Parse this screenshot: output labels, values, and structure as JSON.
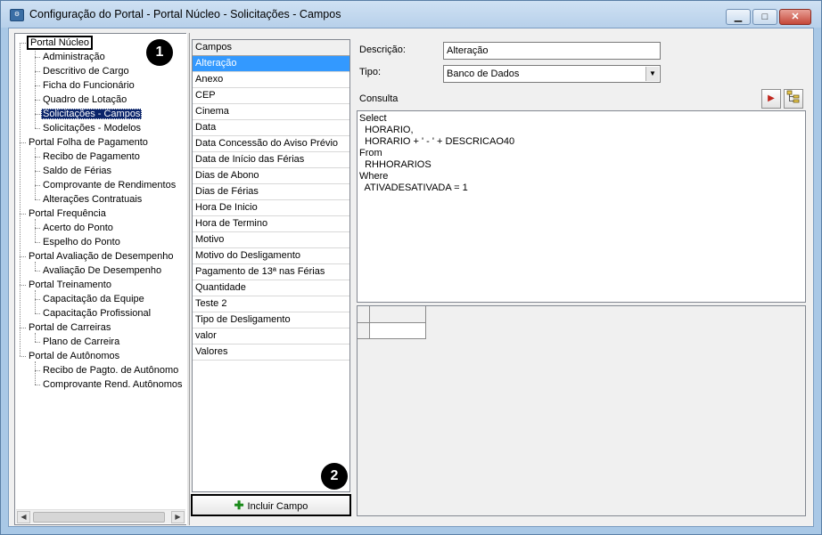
{
  "window": {
    "title": "Configuração do Portal - Portal Núcleo - Solicitações - Campos",
    "minimize": "▁",
    "maximize": "□",
    "close": "✕"
  },
  "tree": {
    "items": [
      {
        "label": "Portal Núcleo"
      },
      {
        "label": "Administração"
      },
      {
        "label": "Descritivo de Cargo"
      },
      {
        "label": "Ficha do Funcionário"
      },
      {
        "label": "Quadro de Lotação"
      },
      {
        "label": "Solicitações - Campos"
      },
      {
        "label": "Solicitações - Modelos"
      },
      {
        "label": "Portal Folha de Pagamento"
      },
      {
        "label": "Recibo de Pagamento"
      },
      {
        "label": "Saldo de Férias"
      },
      {
        "label": "Comprovante de Rendimentos"
      },
      {
        "label": "Alterações Contratuais"
      },
      {
        "label": "Portal Frequência"
      },
      {
        "label": "Acerto do Ponto"
      },
      {
        "label": "Espelho do Ponto"
      },
      {
        "label": "Portal Avaliação de Desempenho"
      },
      {
        "label": "Avaliação De Desempenho"
      },
      {
        "label": "Portal Treinamento"
      },
      {
        "label": "Capacitação da Equipe"
      },
      {
        "label": "Capacitação Profissional"
      },
      {
        "label": "Portal de Carreiras"
      },
      {
        "label": "Plano de Carreira"
      },
      {
        "label": "Portal de Autônomos"
      },
      {
        "label": "Recibo de Pagto. de Autônomo"
      },
      {
        "label": "Comprovante Rend. Autônomos"
      }
    ],
    "selected": "Solicitações - Campos"
  },
  "fields": {
    "header": "Campos",
    "items": [
      "Alteração",
      "Anexo",
      "CEP",
      "Cinema",
      "Data",
      "Data Concessão do Aviso Prévio",
      "Data de Início das Férias",
      "Dias de Abono",
      "Dias de Férias",
      "Hora De Inicio",
      "Hora de Termino",
      "Motivo",
      "Motivo do Desligamento",
      "Pagamento de 13ª nas Férias",
      "Quantidade",
      "Teste 2",
      "Tipo de Desligamento",
      "valor",
      "Valores"
    ],
    "selected": "Alteração",
    "add_button": "Incluir Campo"
  },
  "form": {
    "descricao_label": "Descrição:",
    "descricao_value": "Alteração",
    "tipo_label": "Tipo:",
    "tipo_value": "Banco de Dados",
    "consulta_label": "Consulta",
    "query": "Select\n  HORARIO,\n  HORARIO + ' - ' + DESCRICAO40\nFrom\n  RHHORARIOS\nWhere\n  ATIVADESATIVADA = 1"
  },
  "badges": {
    "one": "1",
    "two": "2"
  },
  "colors": {
    "selection": "#0a246a",
    "list_selection": "#3399ff",
    "window_frame": "#a9c8e6"
  }
}
